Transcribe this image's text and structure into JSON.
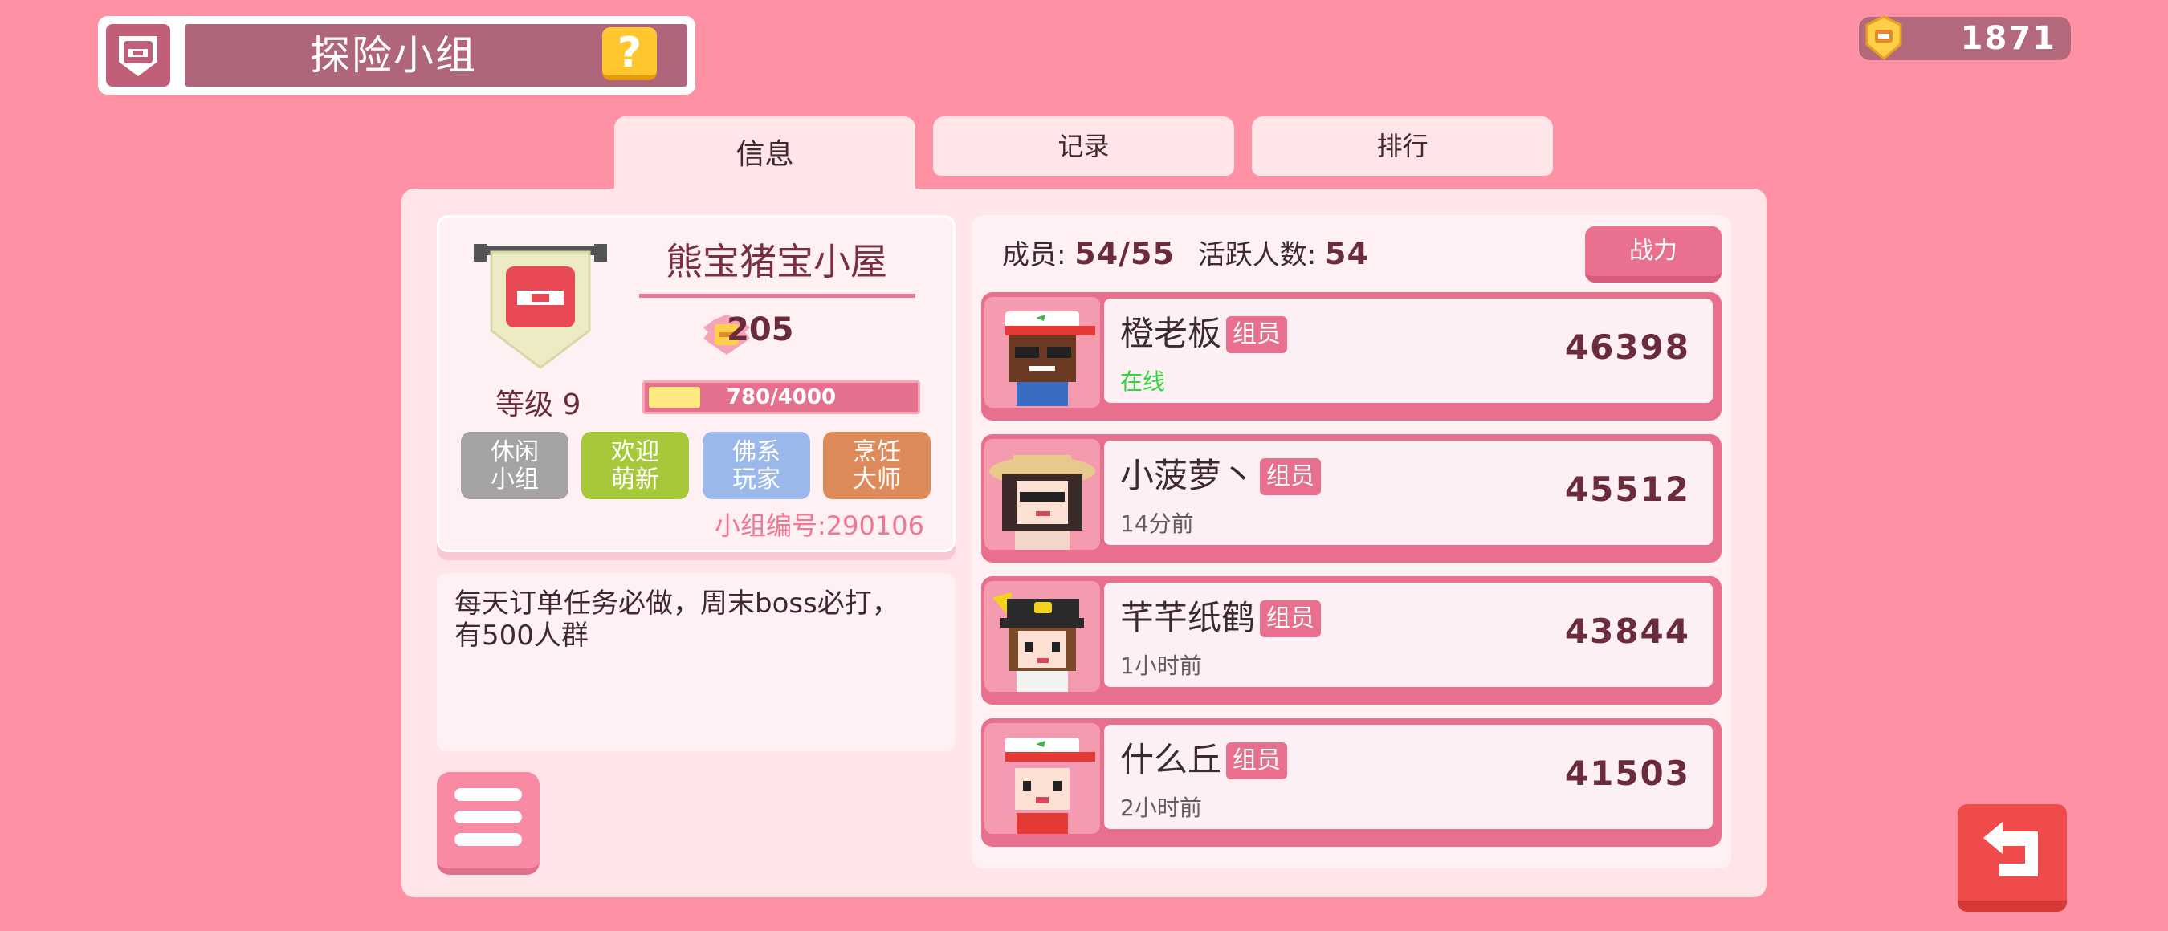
{
  "header": {
    "title": "探险小组",
    "help_label": "?",
    "currency_value": "1871"
  },
  "tabs": [
    {
      "label": "信息",
      "active": true
    },
    {
      "label": "记录",
      "active": false
    },
    {
      "label": "排行",
      "active": false
    }
  ],
  "group": {
    "name": "熊宝猪宝小屋",
    "rating": "205",
    "level_label": "等级 9",
    "exp_text": "780/4000",
    "exp_fraction": 0.195,
    "tags": [
      {
        "label": "休闲\n小组",
        "color": "#a6a3a5"
      },
      {
        "label": "欢迎\n萌新",
        "color": "#a6c83a"
      },
      {
        "label": "佛系\n玩家",
        "color": "#9ab9ea"
      },
      {
        "label": "烹饪\n大师",
        "color": "#dd8b5a"
      }
    ],
    "id_text": "小组编号:290106",
    "description": "每天订单任务必做，周末boss必打，有500人群"
  },
  "members": {
    "count_label": "成员:",
    "count_value": "54/55",
    "active_label": "活跃人数:",
    "active_value": "54",
    "sort_button": "战力",
    "list": [
      {
        "name": "橙老板",
        "role": "组员",
        "status": "在线",
        "online": true,
        "score": "46398"
      },
      {
        "name": "小菠萝丶",
        "role": "组员",
        "status": "14分前",
        "online": false,
        "score": "45512"
      },
      {
        "name": "芊芊纸鹤",
        "role": "组员",
        "status": "1小时前",
        "online": false,
        "score": "43844"
      },
      {
        "name": "什么丘",
        "role": "组员",
        "status": "2小时前",
        "online": false,
        "score": "41503"
      }
    ]
  },
  "colors": {
    "background": "#ff91a4",
    "accent": "#e86f8d",
    "online": "#2fd63a",
    "back_button": "#ef4b4b"
  },
  "icons": [
    "group-shield-icon",
    "help-icon",
    "currency-icon",
    "rating-badge-icon",
    "menu-icon",
    "back-arrow-icon"
  ]
}
